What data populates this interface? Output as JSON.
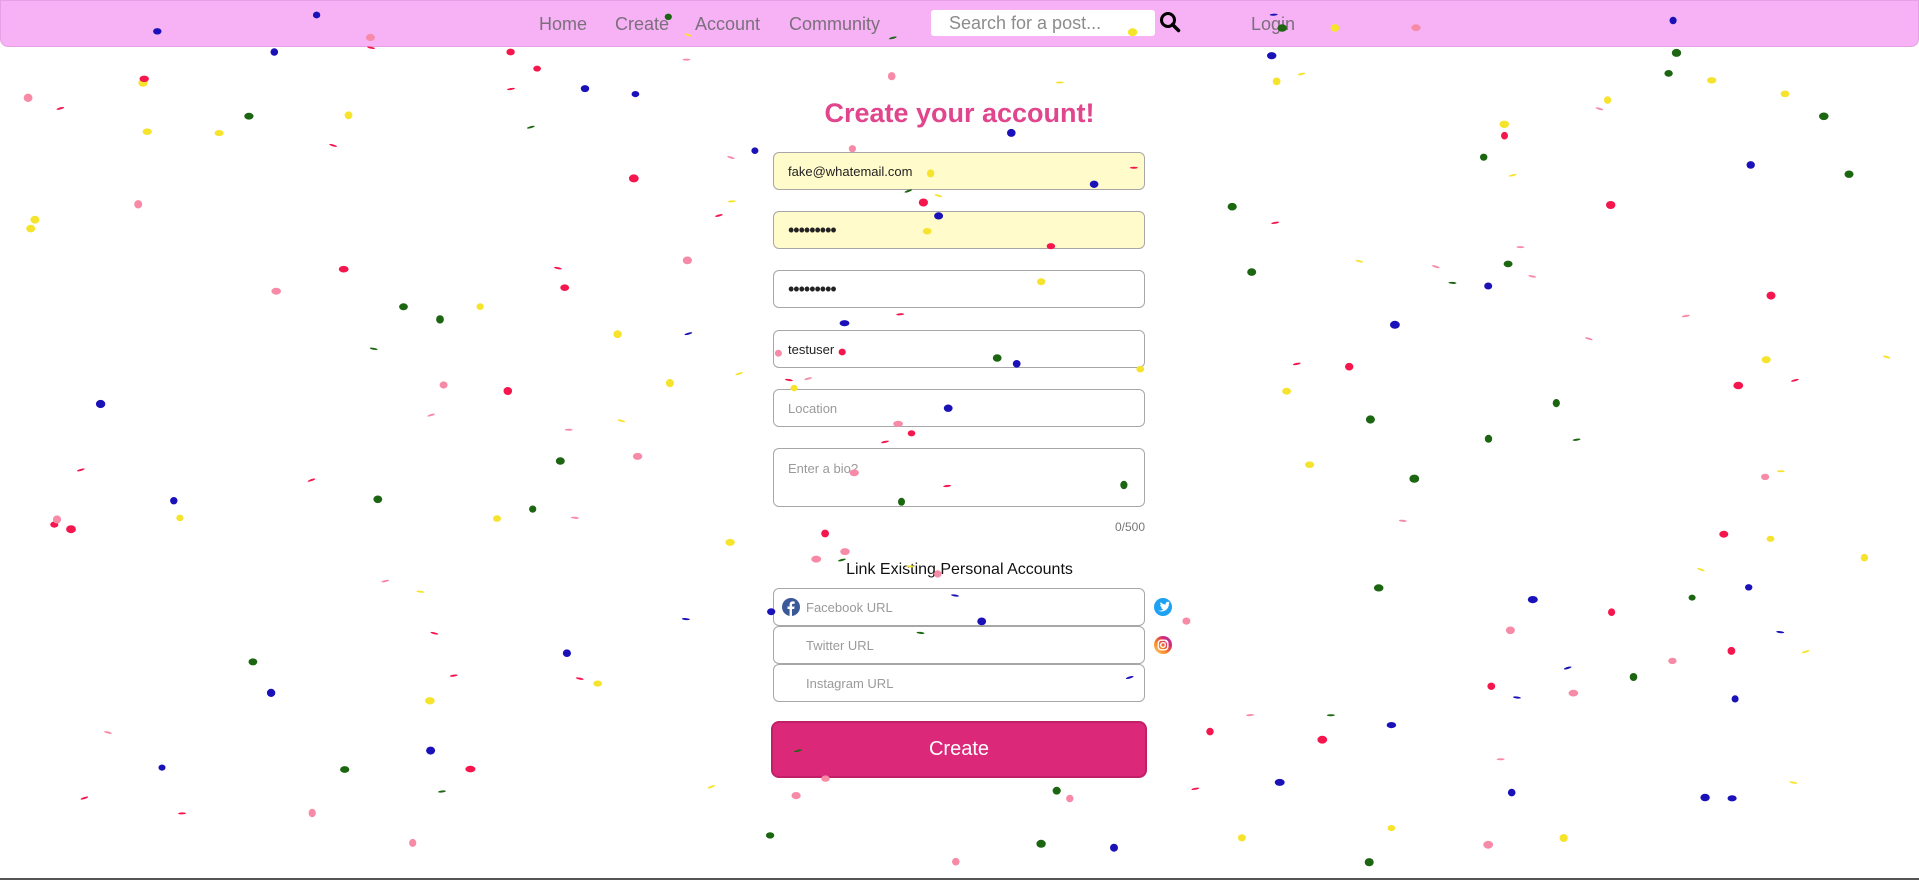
{
  "nav": {
    "links": [
      "Home",
      "Create",
      "Account",
      "Community"
    ],
    "search_placeholder": "Search for a post...",
    "search_icon": "search-icon",
    "login": "Login",
    "background": "#f7b2f6"
  },
  "form": {
    "title": "Create your account!",
    "email": "fake@whatemail.com",
    "password": "•••••••••",
    "confirm_password": "•••••••••",
    "username": "testuser",
    "location_placeholder": "Location",
    "bio_placeholder": "Enter a bio?",
    "bio_counter": "0/500",
    "link_heading": "Link Existing Personal Accounts",
    "facebook_placeholder": "Facebook URL",
    "twitter_placeholder": "Twitter URL",
    "instagram_placeholder": "Instagram URL",
    "create_label": "Create"
  },
  "colors": {
    "accent": "#dc2879",
    "title": "#e0458e",
    "autofill": "#fffbcb",
    "confetti": [
      "#f5164e",
      "#1a12b8",
      "#f6e32b",
      "#1c6612",
      "#f78aa7"
    ]
  }
}
